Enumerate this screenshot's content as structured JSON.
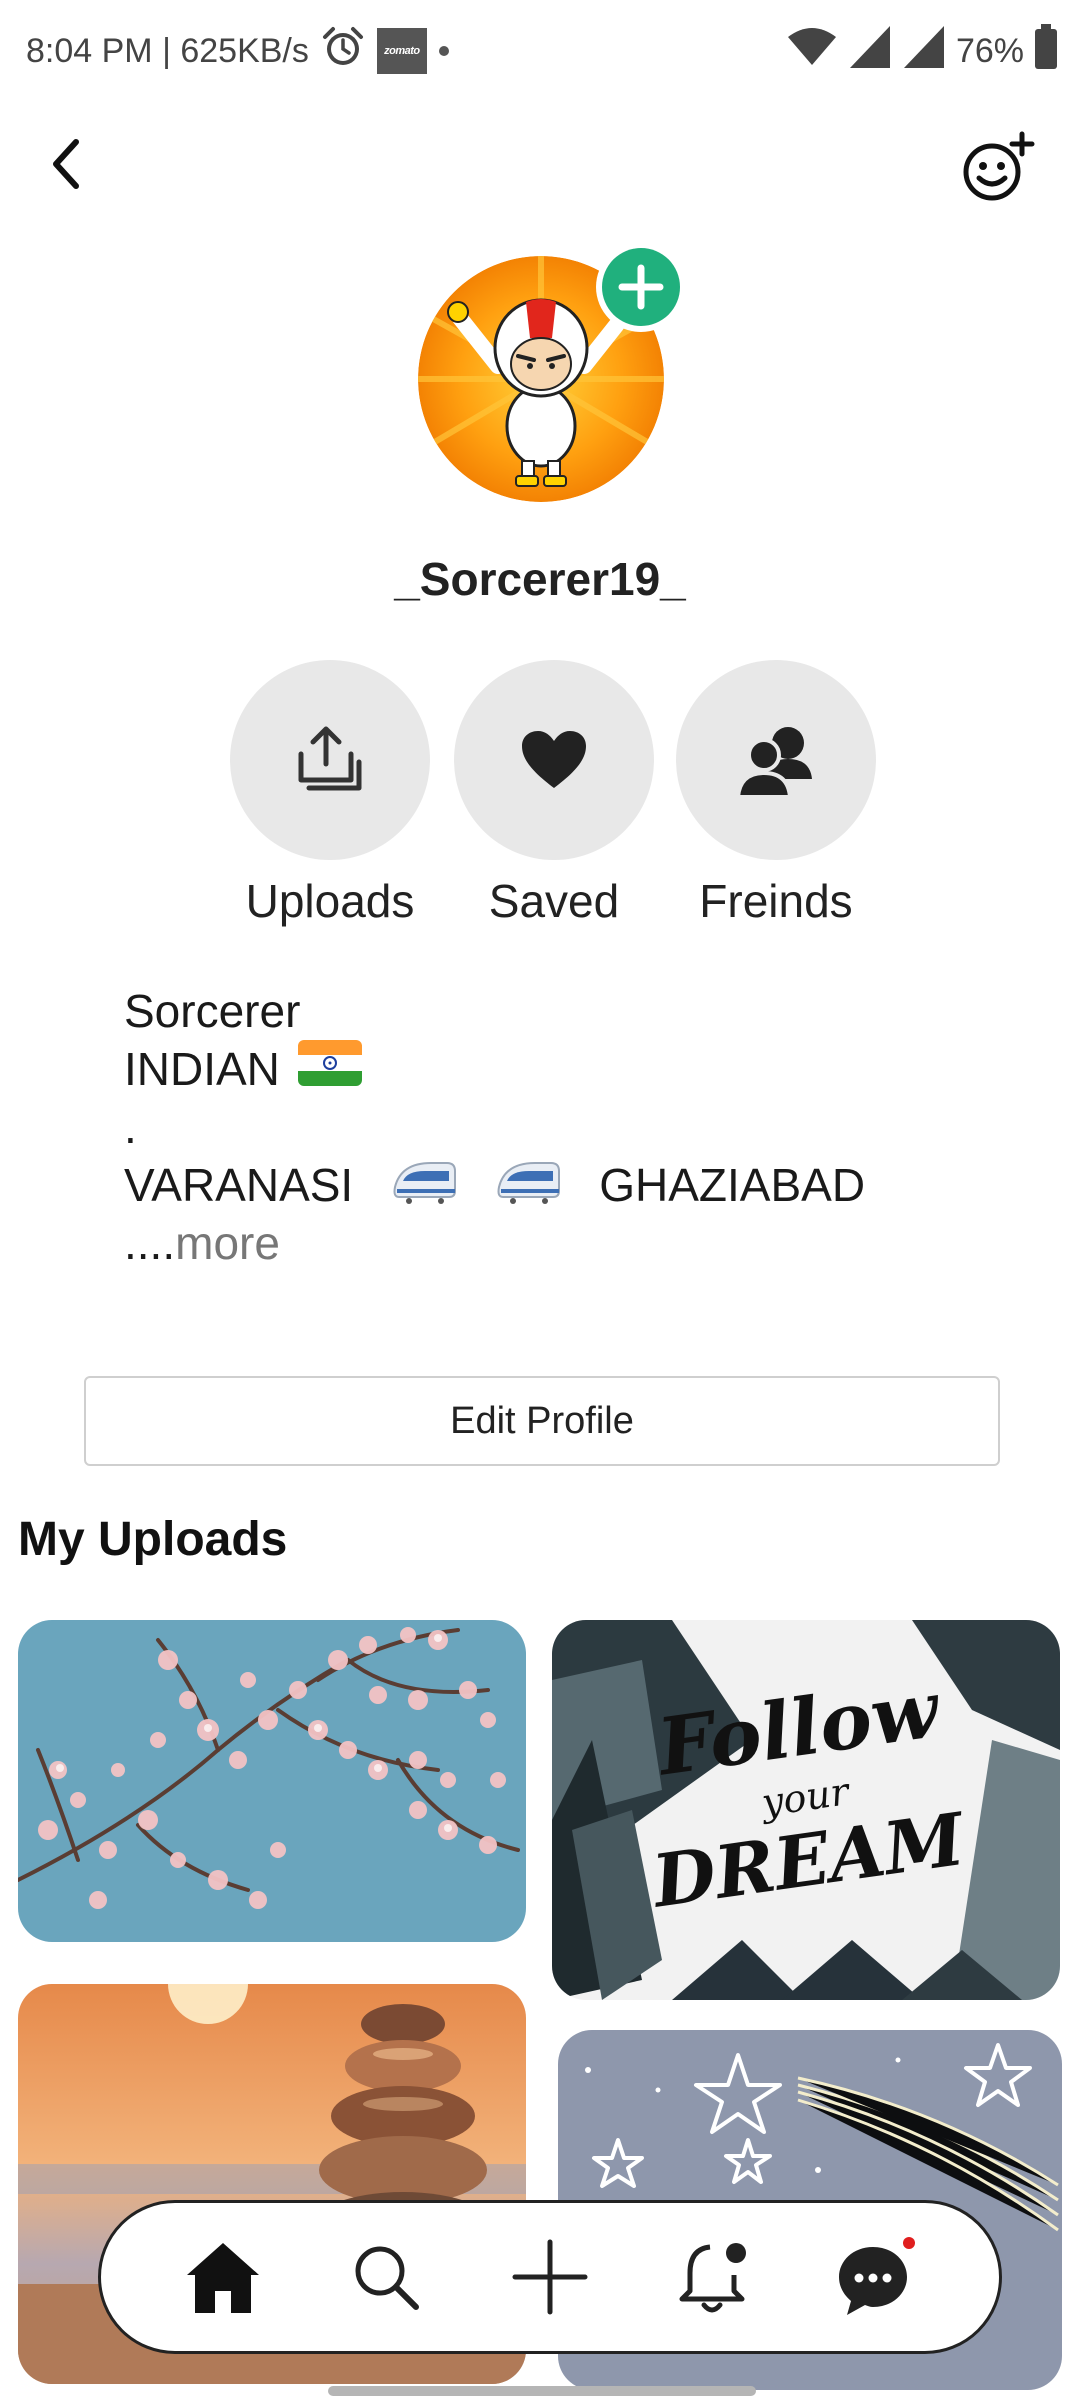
{
  "status_bar": {
    "time_speed": "8:04 PM | 625KB/s",
    "zomato_label": "zomato",
    "battery": "76%",
    "icons": [
      "alarm-icon",
      "zomato-notification-icon",
      "wifi-icon",
      "signal-icon",
      "signal-icon",
      "battery-icon"
    ]
  },
  "header": {
    "back_icon": "chevron-left-icon",
    "add_friend_icon": "smiley-plus-icon"
  },
  "profile": {
    "username": "_Sorcerer19_",
    "avatar_add_icon": "plus-icon"
  },
  "actions": [
    {
      "label": "Uploads",
      "icon": "upload-stack-icon"
    },
    {
      "label": "Saved",
      "icon": "heart-icon"
    },
    {
      "label": "Freinds",
      "icon": "friends-icon"
    }
  ],
  "bio": {
    "line1": "Sorcerer",
    "line2": "INDIAN",
    "line3": ".",
    "line4_from": "VARANASI",
    "line4_to": "GHAZIABAD",
    "more_dots": "....",
    "more_label": "more"
  },
  "edit_profile_label": "Edit Profile",
  "uploads_section": {
    "title": "My Uploads",
    "items": [
      {
        "subject": "cherry blossom branches against blue sky"
      },
      {
        "subject": "Follow your Dream",
        "image_text_line1": "Follow",
        "image_text_line2": "your",
        "image_text_line3": "DREAM"
      },
      {
        "subject": "stacked stones at sunset beach"
      },
      {
        "subject": "doodle stars and shooting star"
      }
    ]
  },
  "bottom_nav": [
    {
      "name": "home",
      "icon": "home-icon",
      "active": true
    },
    {
      "name": "search",
      "icon": "search-icon",
      "active": false
    },
    {
      "name": "create",
      "icon": "plus-icon",
      "active": false
    },
    {
      "name": "notifications",
      "icon": "bell-icon",
      "active": false
    },
    {
      "name": "messages",
      "icon": "chat-icon",
      "active": false
    }
  ],
  "colors": {
    "accent_green": "#20b07d",
    "circle_bg": "#e8e8e8",
    "notify_red": "#e01e1e"
  }
}
